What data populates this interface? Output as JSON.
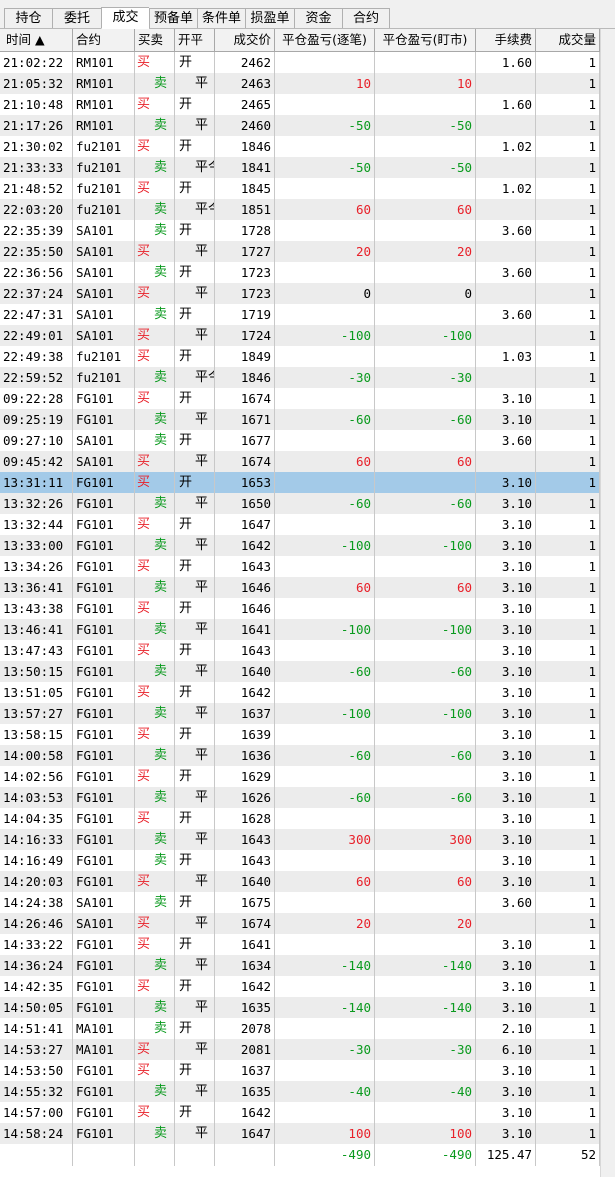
{
  "tabs": [
    {
      "label": "持仓",
      "active": false
    },
    {
      "label": "委托",
      "active": false
    },
    {
      "label": "成交",
      "active": true
    },
    {
      "label": "预备单",
      "active": false
    },
    {
      "label": "条件单",
      "active": false
    },
    {
      "label": "损盈单",
      "active": false
    },
    {
      "label": "资金",
      "active": false
    },
    {
      "label": "合约",
      "active": false
    }
  ],
  "columns": [
    "时间 ▲",
    "合约",
    "买卖",
    "开平",
    "成交价",
    "平仓盈亏(逐笔)",
    "平仓盈亏(盯市)",
    "手续费",
    "成交量"
  ],
  "rows": [
    {
      "time": "21:02:22",
      "contract": "RM101",
      "side": "买",
      "oc": "开",
      "price": "2462",
      "pnl_trade": "",
      "pnl_mark": "",
      "fee": "1.60",
      "qty": "1"
    },
    {
      "time": "21:05:32",
      "contract": "RM101",
      "side": "卖",
      "oc": "平",
      "price": "2463",
      "pnl_trade": "10",
      "pnl_mark": "10",
      "fee": "",
      "qty": "1"
    },
    {
      "time": "21:10:48",
      "contract": "RM101",
      "side": "买",
      "oc": "开",
      "price": "2465",
      "pnl_trade": "",
      "pnl_mark": "",
      "fee": "1.60",
      "qty": "1"
    },
    {
      "time": "21:17:26",
      "contract": "RM101",
      "side": "卖",
      "oc": "平",
      "price": "2460",
      "pnl_trade": "-50",
      "pnl_mark": "-50",
      "fee": "",
      "qty": "1"
    },
    {
      "time": "21:30:02",
      "contract": "fu2101",
      "side": "买",
      "oc": "开",
      "price": "1846",
      "pnl_trade": "",
      "pnl_mark": "",
      "fee": "1.02",
      "qty": "1"
    },
    {
      "time": "21:33:33",
      "contract": "fu2101",
      "side": "卖",
      "oc": "平今",
      "price": "1841",
      "pnl_trade": "-50",
      "pnl_mark": "-50",
      "fee": "",
      "qty": "1"
    },
    {
      "time": "21:48:52",
      "contract": "fu2101",
      "side": "买",
      "oc": "开",
      "price": "1845",
      "pnl_trade": "",
      "pnl_mark": "",
      "fee": "1.02",
      "qty": "1"
    },
    {
      "time": "22:03:20",
      "contract": "fu2101",
      "side": "卖",
      "oc": "平今",
      "price": "1851",
      "pnl_trade": "60",
      "pnl_mark": "60",
      "fee": "",
      "qty": "1"
    },
    {
      "time": "22:35:39",
      "contract": "SA101",
      "side": "卖",
      "oc": "开",
      "price": "1728",
      "pnl_trade": "",
      "pnl_mark": "",
      "fee": "3.60",
      "qty": "1"
    },
    {
      "time": "22:35:50",
      "contract": "SA101",
      "side": "买",
      "oc": "平",
      "price": "1727",
      "pnl_trade": "20",
      "pnl_mark": "20",
      "fee": "",
      "qty": "1"
    },
    {
      "time": "22:36:56",
      "contract": "SA101",
      "side": "卖",
      "oc": "开",
      "price": "1723",
      "pnl_trade": "",
      "pnl_mark": "",
      "fee": "3.60",
      "qty": "1"
    },
    {
      "time": "22:37:24",
      "contract": "SA101",
      "side": "买",
      "oc": "平",
      "price": "1723",
      "pnl_trade": "0",
      "pnl_mark": "0",
      "fee": "",
      "qty": "1"
    },
    {
      "time": "22:47:31",
      "contract": "SA101",
      "side": "卖",
      "oc": "开",
      "price": "1719",
      "pnl_trade": "",
      "pnl_mark": "",
      "fee": "3.60",
      "qty": "1"
    },
    {
      "time": "22:49:01",
      "contract": "SA101",
      "side": "买",
      "oc": "平",
      "price": "1724",
      "pnl_trade": "-100",
      "pnl_mark": "-100",
      "fee": "",
      "qty": "1"
    },
    {
      "time": "22:49:38",
      "contract": "fu2101",
      "side": "买",
      "oc": "开",
      "price": "1849",
      "pnl_trade": "",
      "pnl_mark": "",
      "fee": "1.03",
      "qty": "1"
    },
    {
      "time": "22:59:52",
      "contract": "fu2101",
      "side": "卖",
      "oc": "平今",
      "price": "1846",
      "pnl_trade": "-30",
      "pnl_mark": "-30",
      "fee": "",
      "qty": "1"
    },
    {
      "time": "09:22:28",
      "contract": "FG101",
      "side": "买",
      "oc": "开",
      "price": "1674",
      "pnl_trade": "",
      "pnl_mark": "",
      "fee": "3.10",
      "qty": "1"
    },
    {
      "time": "09:25:19",
      "contract": "FG101",
      "side": "卖",
      "oc": "平",
      "price": "1671",
      "pnl_trade": "-60",
      "pnl_mark": "-60",
      "fee": "3.10",
      "qty": "1"
    },
    {
      "time": "09:27:10",
      "contract": "SA101",
      "side": "卖",
      "oc": "开",
      "price": "1677",
      "pnl_trade": "",
      "pnl_mark": "",
      "fee": "3.60",
      "qty": "1"
    },
    {
      "time": "09:45:42",
      "contract": "SA101",
      "side": "买",
      "oc": "平",
      "price": "1674",
      "pnl_trade": "60",
      "pnl_mark": "60",
      "fee": "",
      "qty": "1"
    },
    {
      "time": "13:31:11",
      "contract": "FG101",
      "side": "买",
      "oc": "开",
      "price": "1653",
      "pnl_trade": "",
      "pnl_mark": "",
      "fee": "3.10",
      "qty": "1",
      "selected": true
    },
    {
      "time": "13:32:26",
      "contract": "FG101",
      "side": "卖",
      "oc": "平",
      "price": "1650",
      "pnl_trade": "-60",
      "pnl_mark": "-60",
      "fee": "3.10",
      "qty": "1"
    },
    {
      "time": "13:32:44",
      "contract": "FG101",
      "side": "买",
      "oc": "开",
      "price": "1647",
      "pnl_trade": "",
      "pnl_mark": "",
      "fee": "3.10",
      "qty": "1"
    },
    {
      "time": "13:33:00",
      "contract": "FG101",
      "side": "卖",
      "oc": "平",
      "price": "1642",
      "pnl_trade": "-100",
      "pnl_mark": "-100",
      "fee": "3.10",
      "qty": "1"
    },
    {
      "time": "13:34:26",
      "contract": "FG101",
      "side": "买",
      "oc": "开",
      "price": "1643",
      "pnl_trade": "",
      "pnl_mark": "",
      "fee": "3.10",
      "qty": "1"
    },
    {
      "time": "13:36:41",
      "contract": "FG101",
      "side": "卖",
      "oc": "平",
      "price": "1646",
      "pnl_trade": "60",
      "pnl_mark": "60",
      "fee": "3.10",
      "qty": "1"
    },
    {
      "time": "13:43:38",
      "contract": "FG101",
      "side": "买",
      "oc": "开",
      "price": "1646",
      "pnl_trade": "",
      "pnl_mark": "",
      "fee": "3.10",
      "qty": "1"
    },
    {
      "time": "13:46:41",
      "contract": "FG101",
      "side": "卖",
      "oc": "平",
      "price": "1641",
      "pnl_trade": "-100",
      "pnl_mark": "-100",
      "fee": "3.10",
      "qty": "1"
    },
    {
      "time": "13:47:43",
      "contract": "FG101",
      "side": "买",
      "oc": "开",
      "price": "1643",
      "pnl_trade": "",
      "pnl_mark": "",
      "fee": "3.10",
      "qty": "1"
    },
    {
      "time": "13:50:15",
      "contract": "FG101",
      "side": "卖",
      "oc": "平",
      "price": "1640",
      "pnl_trade": "-60",
      "pnl_mark": "-60",
      "fee": "3.10",
      "qty": "1"
    },
    {
      "time": "13:51:05",
      "contract": "FG101",
      "side": "买",
      "oc": "开",
      "price": "1642",
      "pnl_trade": "",
      "pnl_mark": "",
      "fee": "3.10",
      "qty": "1"
    },
    {
      "time": "13:57:27",
      "contract": "FG101",
      "side": "卖",
      "oc": "平",
      "price": "1637",
      "pnl_trade": "-100",
      "pnl_mark": "-100",
      "fee": "3.10",
      "qty": "1"
    },
    {
      "time": "13:58:15",
      "contract": "FG101",
      "side": "买",
      "oc": "开",
      "price": "1639",
      "pnl_trade": "",
      "pnl_mark": "",
      "fee": "3.10",
      "qty": "1"
    },
    {
      "time": "14:00:58",
      "contract": "FG101",
      "side": "卖",
      "oc": "平",
      "price": "1636",
      "pnl_trade": "-60",
      "pnl_mark": "-60",
      "fee": "3.10",
      "qty": "1"
    },
    {
      "time": "14:02:56",
      "contract": "FG101",
      "side": "买",
      "oc": "开",
      "price": "1629",
      "pnl_trade": "",
      "pnl_mark": "",
      "fee": "3.10",
      "qty": "1"
    },
    {
      "time": "14:03:53",
      "contract": "FG101",
      "side": "卖",
      "oc": "平",
      "price": "1626",
      "pnl_trade": "-60",
      "pnl_mark": "-60",
      "fee": "3.10",
      "qty": "1"
    },
    {
      "time": "14:04:35",
      "contract": "FG101",
      "side": "买",
      "oc": "开",
      "price": "1628",
      "pnl_trade": "",
      "pnl_mark": "",
      "fee": "3.10",
      "qty": "1"
    },
    {
      "time": "14:16:33",
      "contract": "FG101",
      "side": "卖",
      "oc": "平",
      "price": "1643",
      "pnl_trade": "300",
      "pnl_mark": "300",
      "fee": "3.10",
      "qty": "1"
    },
    {
      "time": "14:16:49",
      "contract": "FG101",
      "side": "卖",
      "oc": "开",
      "price": "1643",
      "pnl_trade": "",
      "pnl_mark": "",
      "fee": "3.10",
      "qty": "1"
    },
    {
      "time": "14:20:03",
      "contract": "FG101",
      "side": "买",
      "oc": "平",
      "price": "1640",
      "pnl_trade": "60",
      "pnl_mark": "60",
      "fee": "3.10",
      "qty": "1"
    },
    {
      "time": "14:24:38",
      "contract": "SA101",
      "side": "卖",
      "oc": "开",
      "price": "1675",
      "pnl_trade": "",
      "pnl_mark": "",
      "fee": "3.60",
      "qty": "1"
    },
    {
      "time": "14:26:46",
      "contract": "SA101",
      "side": "买",
      "oc": "平",
      "price": "1674",
      "pnl_trade": "20",
      "pnl_mark": "20",
      "fee": "",
      "qty": "1"
    },
    {
      "time": "14:33:22",
      "contract": "FG101",
      "side": "买",
      "oc": "开",
      "price": "1641",
      "pnl_trade": "",
      "pnl_mark": "",
      "fee": "3.10",
      "qty": "1"
    },
    {
      "time": "14:36:24",
      "contract": "FG101",
      "side": "卖",
      "oc": "平",
      "price": "1634",
      "pnl_trade": "-140",
      "pnl_mark": "-140",
      "fee": "3.10",
      "qty": "1"
    },
    {
      "time": "14:42:35",
      "contract": "FG101",
      "side": "买",
      "oc": "开",
      "price": "1642",
      "pnl_trade": "",
      "pnl_mark": "",
      "fee": "3.10",
      "qty": "1"
    },
    {
      "time": "14:50:05",
      "contract": "FG101",
      "side": "卖",
      "oc": "平",
      "price": "1635",
      "pnl_trade": "-140",
      "pnl_mark": "-140",
      "fee": "3.10",
      "qty": "1"
    },
    {
      "time": "14:51:41",
      "contract": "MA101",
      "side": "卖",
      "oc": "开",
      "price": "2078",
      "pnl_trade": "",
      "pnl_mark": "",
      "fee": "2.10",
      "qty": "1"
    },
    {
      "time": "14:53:27",
      "contract": "MA101",
      "side": "买",
      "oc": "平",
      "price": "2081",
      "pnl_trade": "-30",
      "pnl_mark": "-30",
      "fee": "6.10",
      "qty": "1"
    },
    {
      "time": "14:53:50",
      "contract": "FG101",
      "side": "买",
      "oc": "开",
      "price": "1637",
      "pnl_trade": "",
      "pnl_mark": "",
      "fee": "3.10",
      "qty": "1"
    },
    {
      "time": "14:55:32",
      "contract": "FG101",
      "side": "卖",
      "oc": "平",
      "price": "1635",
      "pnl_trade": "-40",
      "pnl_mark": "-40",
      "fee": "3.10",
      "qty": "1"
    },
    {
      "time": "14:57:00",
      "contract": "FG101",
      "side": "买",
      "oc": "开",
      "price": "1642",
      "pnl_trade": "",
      "pnl_mark": "",
      "fee": "3.10",
      "qty": "1"
    },
    {
      "time": "14:58:24",
      "contract": "FG101",
      "side": "卖",
      "oc": "平",
      "price": "1647",
      "pnl_trade": "100",
      "pnl_mark": "100",
      "fee": "3.10",
      "qty": "1"
    }
  ],
  "totals": {
    "pnl_trade": "-490",
    "pnl_mark": "-490",
    "fee": "125.47",
    "qty": "52"
  },
  "colors": {
    "profit": "#e8212a",
    "loss": "#0a9a1e",
    "buy": "#e8212a",
    "sell": "#0a9a1e",
    "selected_row": "#a3cae8"
  }
}
